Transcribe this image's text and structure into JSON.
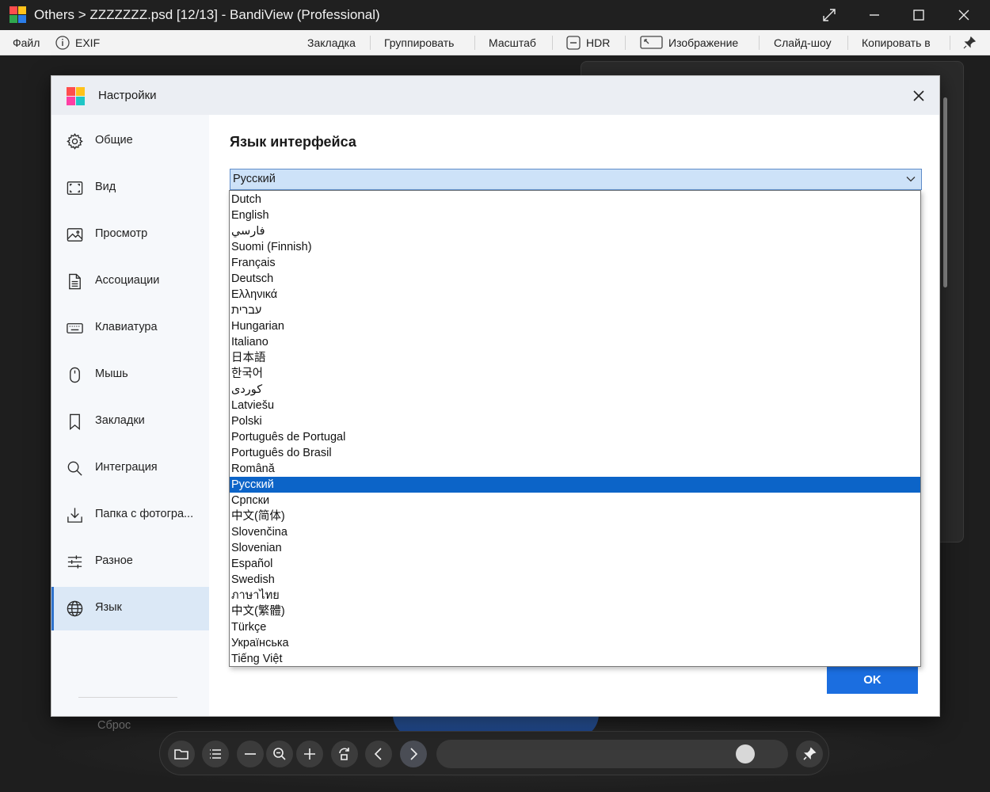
{
  "window": {
    "title": "Others > ZZZZZZZ.psd [12/13] - BandiView (Professional)"
  },
  "menubar": {
    "file": "Файл",
    "exif": "EXIF",
    "bookmark": "Закладка",
    "group": "Группировать",
    "scale": "Масштаб",
    "hdr": "HDR",
    "image": "Изображение",
    "slideshow": "Слайд-шоу",
    "copy_to": "Копировать в"
  },
  "dialog": {
    "title": "Настройки",
    "section_title": "Язык интерфейса",
    "selected_language": "Русский",
    "ok_label": "OK",
    "reset_label": "Сброс",
    "sidebar": [
      {
        "label": "Общие",
        "icon": "gear-icon"
      },
      {
        "label": "Вид",
        "icon": "frame-icon"
      },
      {
        "label": "Просмотр",
        "icon": "image-icon"
      },
      {
        "label": "Ассоциации",
        "icon": "document-icon"
      },
      {
        "label": "Клавиатура",
        "icon": "keyboard-icon"
      },
      {
        "label": "Мышь",
        "icon": "mouse-icon"
      },
      {
        "label": "Закладки",
        "icon": "bookmark-icon"
      },
      {
        "label": "Интеграция",
        "icon": "search-icon"
      },
      {
        "label": "Папка с фотогра...",
        "icon": "download-icon"
      },
      {
        "label": "Разное",
        "icon": "sliders-icon"
      },
      {
        "label": "Язык",
        "icon": "globe-icon",
        "active": true
      }
    ]
  },
  "language_options": [
    "Dutch",
    "English",
    "فارسي",
    "Suomi (Finnish)",
    "Français",
    "Deutsch",
    "Ελληνικά",
    "עברית",
    "Hungarian",
    "Italiano",
    "日本語",
    "한국어",
    "كوردى",
    "Latviešu",
    "Polski",
    "Português de Portugal",
    "Português do Brasil",
    "Română",
    "Русский",
    "Српски",
    "中文(简体)",
    "Slovenčina",
    "Slovenian",
    "Español",
    "Swedish",
    "ภาษาไทย",
    "中文(繁體)",
    "Türkçe",
    "Українська",
    "Tiếng Việt"
  ],
  "colors": {
    "accent": "#1b6ee0",
    "selection": "#0c64c8",
    "sidebar_active": "#dbe8f6"
  }
}
